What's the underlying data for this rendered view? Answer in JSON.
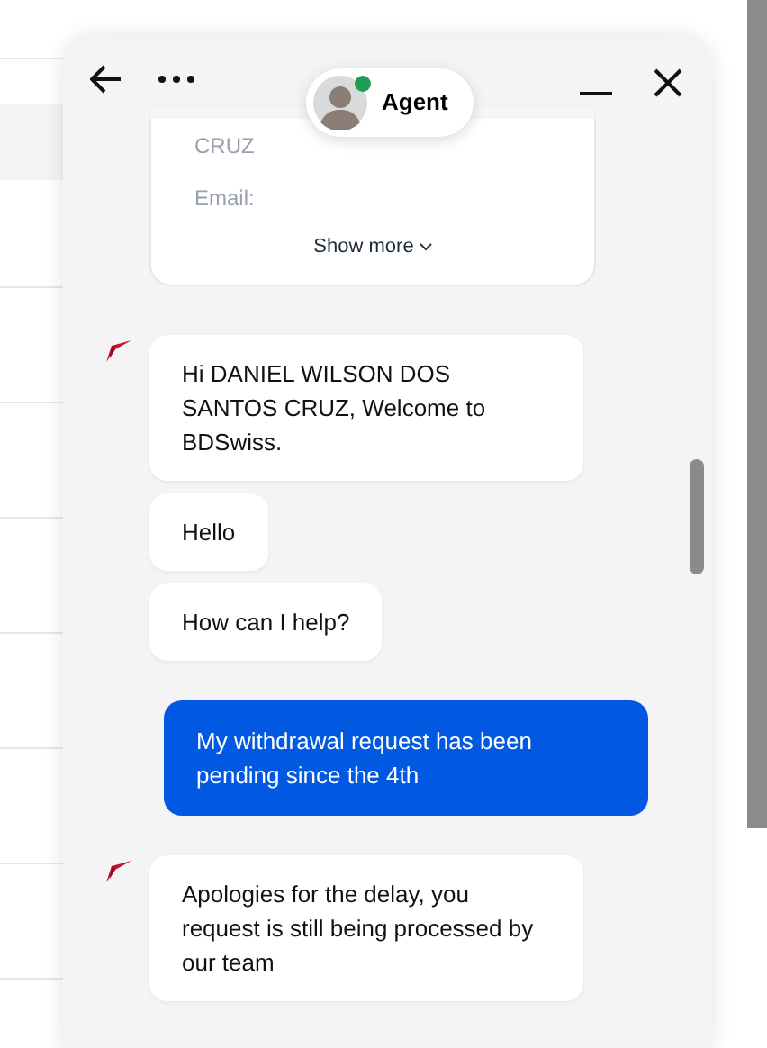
{
  "header": {
    "agent": {
      "name": "Agent",
      "online": true
    }
  },
  "info_card": {
    "lines": [
      "CRUZ",
      "Email:"
    ],
    "show_more": "Show more"
  },
  "messages": [
    {
      "kind": "bot",
      "show_logo": true,
      "text": "Hi DANIEL WILSON DOS SANTOS CRUZ, Welcome to BDSwiss."
    },
    {
      "kind": "bot",
      "show_logo": false,
      "text": "Hello"
    },
    {
      "kind": "bot",
      "show_logo": false,
      "text": "How can I help?"
    },
    {
      "kind": "user",
      "text": "My withdrawal request has been pending since the 4th"
    },
    {
      "kind": "bot",
      "show_logo": true,
      "text": "Apologies for the delay, you request is still being processed by our team"
    }
  ]
}
